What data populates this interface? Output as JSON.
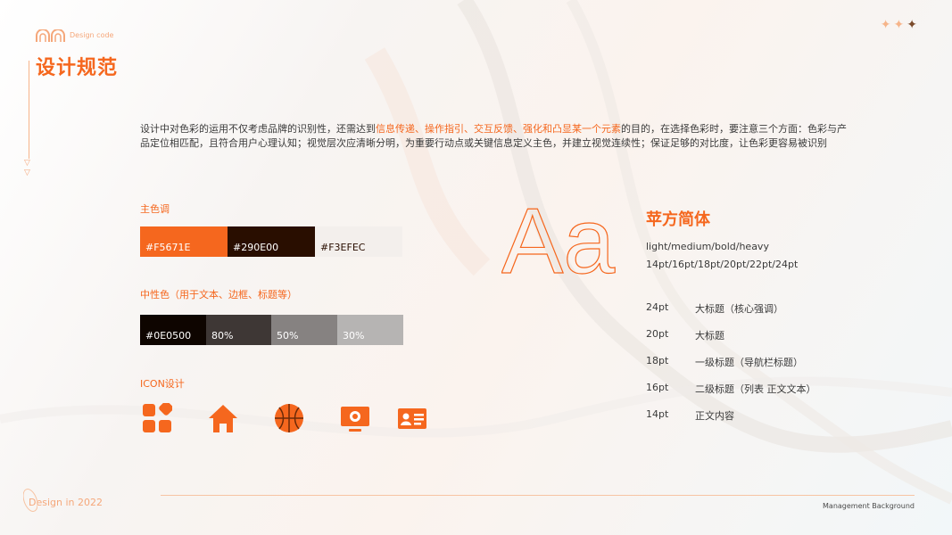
{
  "header": {
    "small_label": "Design code",
    "title": "设计规范",
    "icons": [
      "double-arch-logo-icon",
      "sparkle-icon"
    ]
  },
  "intro": {
    "part1": "设计中对色彩的运用不仅考虑品牌的识别性，还需达到",
    "highlight": "信息传递、操作指引、交互反馈、强化和凸显某一个元素",
    "part2": "的目的，在选择色彩时，要注意三个方面：色彩与产品定位相匹配，且符合用户心理认知；视觉层次应清晰分明，为重要行动点或关键信息定义主色，并建立视觉连续性；保证足够的对比度，让色彩更容易被识别"
  },
  "main_colors": {
    "label": "主色调",
    "swatches": [
      {
        "code": "#F5671E",
        "bg": "#F5671E",
        "text_color": "#ffffff"
      },
      {
        "code": "#290E00",
        "bg": "#290E00",
        "text_color": "#ffffff"
      },
      {
        "code": "#F3EFEC",
        "bg": "#F3EFEC",
        "text_color": "#290E00"
      }
    ]
  },
  "neutral_colors": {
    "label": "中性色（用于文本、边框、标题等）",
    "swatches": [
      {
        "code": "#0E0500",
        "bg": "#0E0500",
        "text_color": "#ffffff"
      },
      {
        "code": "80%",
        "bg": "#3e3735",
        "text_color": "#ffffff"
      },
      {
        "code": "50%",
        "bg": "#868281",
        "text_color": "#ffffff"
      },
      {
        "code": "30%",
        "bg": "#b6b4b3",
        "text_color": "#ffffff"
      }
    ]
  },
  "icon_section": {
    "label": "ICON设计",
    "icons": [
      "apps-grid-icon",
      "home-icon",
      "basketball-icon",
      "monitor-settings-icon",
      "id-card-icon"
    ]
  },
  "typography": {
    "sample_glyph": "Aa",
    "font_name": "苹方简体",
    "weights": "light/medium/bold/heavy",
    "sizes": "14pt/16pt/18pt/20pt/22pt/24pt",
    "scale": [
      {
        "size": "24pt",
        "usage": "大标题（核心强调）"
      },
      {
        "size": "20pt",
        "usage": "大标题"
      },
      {
        "size": "18pt",
        "usage": "一级标题（导航栏标题）"
      },
      {
        "size": "16pt",
        "usage": "二级标题（列表 正文文本）"
      },
      {
        "size": "14pt",
        "usage": "正文内容"
      }
    ]
  },
  "footer": {
    "left": "Design in 2022",
    "right": "Management Background"
  },
  "colors": {
    "accent": "#F5671E",
    "dark": "#290E00"
  }
}
